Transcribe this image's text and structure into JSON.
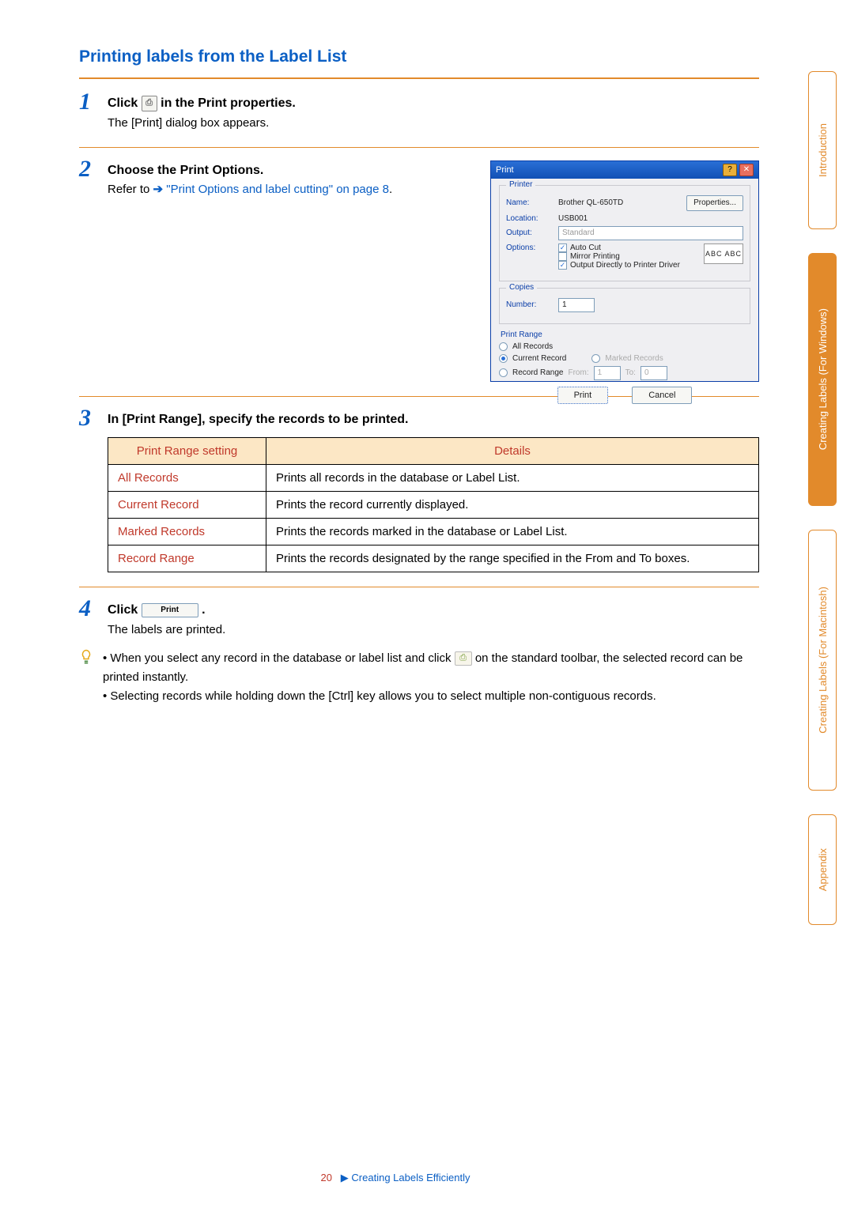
{
  "sideTabs": {
    "t1": "Introduction",
    "t2": "Creating Labels (For Windows)",
    "t3": "Creating Labels (For Macintosh)",
    "t4": "Appendix"
  },
  "section": {
    "title": "Printing labels from the Label List"
  },
  "step1": {
    "head_before": "Click ",
    "head_after": " in the Print properties.",
    "icon_name": "print-properties-icon",
    "body": "The [Print] dialog box appears."
  },
  "step2": {
    "head": "Choose the Print Options.",
    "body_before": "Refer to ",
    "link": "\"Print Options and label cutting\" on page 8",
    "body_after": "."
  },
  "dialog": {
    "title": "Print",
    "help": "?",
    "close": "✕",
    "grp_printer": "Printer",
    "name_lbl": "Name:",
    "name_val": "Brother QL-650TD",
    "loc_lbl": "Location:",
    "loc_val": "USB001",
    "out_lbl": "Output:",
    "out_val": "Standard",
    "opt_lbl": "Options:",
    "opt1": "Auto Cut",
    "opt2": "Mirror Printing",
    "opt3": "Output Directly to Printer Driver",
    "props_btn": "Properties...",
    "abc": "ABC ABC",
    "grp_copies": "Copies",
    "num_lbl": "Number:",
    "num_val": "1",
    "grp_range": "Print Range",
    "r_all": "All Records",
    "r_cur": "Current Record",
    "r_mark": "Marked Records",
    "r_range": "Record Range",
    "from_lbl": "From:",
    "from_val": "1",
    "to_lbl": "To:",
    "to_val": "0",
    "btn_print": "Print",
    "btn_cancel": "Cancel"
  },
  "step3": {
    "head": "In [Print Range], specify the records to be printed.",
    "th1": "Print Range setting",
    "th2": "Details",
    "r1c1": "All Records",
    "r1c2": "Prints all records in the database or Label List.",
    "r2c1": "Current Record",
    "r2c2": "Prints the record currently displayed.",
    "r3c1": "Marked Records",
    "r3c2": "Prints the records marked in the database or Label List.",
    "r4c1": "Record Range",
    "r4c2": "Prints the records designated by the range specified in the From and To boxes."
  },
  "step4": {
    "head_before": "Click ",
    "btn_label": "Print",
    "head_after": ".",
    "body": "The labels are printed."
  },
  "tips": {
    "b1_before": "When you select any record in the database or label list and click ",
    "b1_after": " on the standard toolbar, the selected record can be printed instantly.",
    "b2": "Selecting records while holding down the [Ctrl] key allows you to select multiple non-contiguous records."
  },
  "footer": {
    "page": "20",
    "arrow": "▶",
    "text": "Creating Labels Efficiently"
  }
}
